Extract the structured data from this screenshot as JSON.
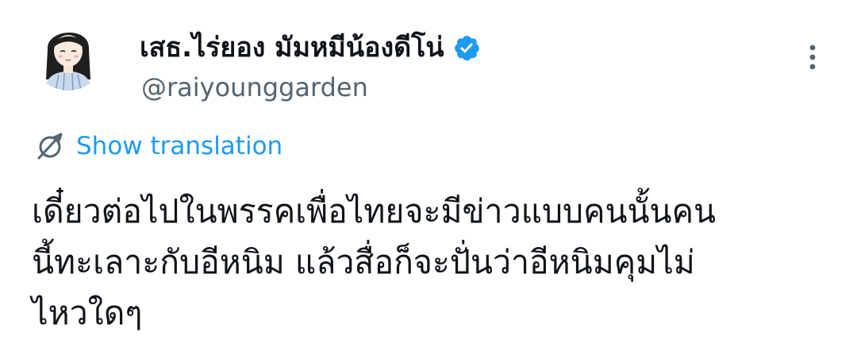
{
  "author": {
    "display_name": "เสธ.ไร่ยอง มัมหมีน้องดีโน่",
    "handle": "@raiyounggarden",
    "verified_icon": "verified-badge-icon",
    "avatar_icon": "cartoon-girl-avatar"
  },
  "menu": {
    "more_icon": "more-vertical-icon"
  },
  "translation": {
    "icon": "translate-globe-icon",
    "label": "Show translation"
  },
  "tweet": {
    "text": "เดี๋ยวต่อไปในพรรคเพื่อไทยจะมีข่าวแบบคนนั้นคน\nนี้ทะเลาะกับอีหนิม แล้วสื่อก็จะปั่นว่าอีหนิมคุมไม่\nไหวใดๆ"
  },
  "colors": {
    "text_primary": "#0f1419",
    "text_secondary": "#536471",
    "accent": "#1d9bf0",
    "verified": "#1d9bf0"
  }
}
